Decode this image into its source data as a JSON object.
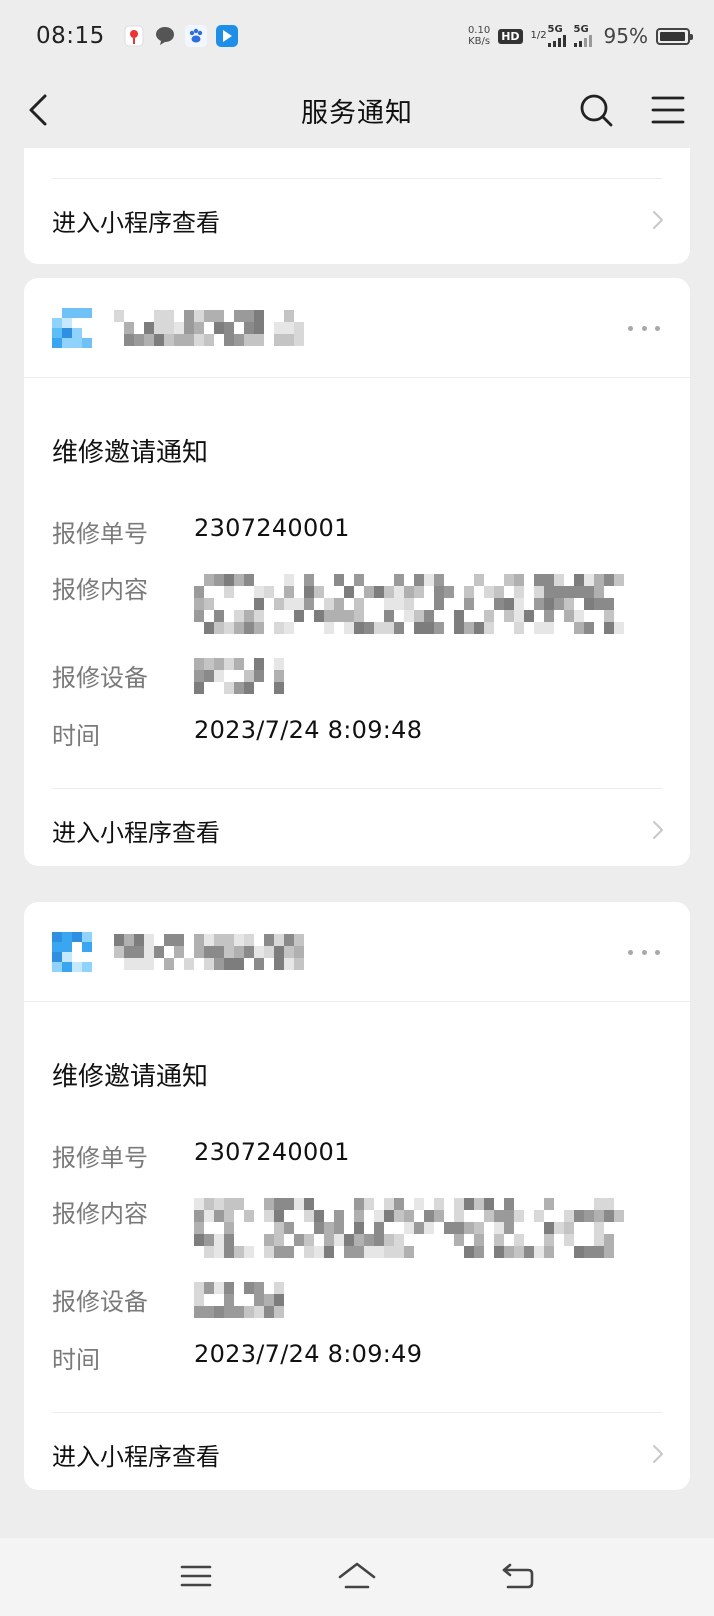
{
  "status_bar": {
    "time": "08:15",
    "net_speed_value": "0.10",
    "net_speed_unit": "KB/s",
    "hd_label": "HD",
    "hd_sub": "1/2",
    "signal1_label": "5G",
    "signal2_label": "5G",
    "battery_text": "95%",
    "battery_level": 0.95,
    "notification_icons": [
      "location-pin-icon",
      "chat-bubble-icon",
      "paw-app-icon",
      "arrow-app-icon"
    ]
  },
  "nav": {
    "title": "服务通知"
  },
  "partial_card": {
    "open_label": "进入小程序查看"
  },
  "cards": [
    {
      "title": "维修邀请通知",
      "rows": [
        {
          "label": "报修单号",
          "value": "2307240001"
        },
        {
          "label": "报修内容",
          "value": ""
        },
        {
          "label": "报修设备",
          "value": ""
        },
        {
          "label": "时间",
          "value": "2023/7/24 8:09:48"
        }
      ],
      "open_label": "进入小程序查看"
    },
    {
      "title": "维修邀请通知",
      "rows": [
        {
          "label": "报修单号",
          "value": "2307240001"
        },
        {
          "label": "报修内容",
          "value": ""
        },
        {
          "label": "报修设备",
          "value": ""
        },
        {
          "label": "时间",
          "value": "2023/7/24 8:09:49"
        }
      ],
      "open_label": "进入小程序查看"
    }
  ],
  "colors": {
    "background": "#ededed",
    "card": "#ffffff",
    "label_gray": "#7a7a7a",
    "logo_blue": "#3aa5f0"
  }
}
